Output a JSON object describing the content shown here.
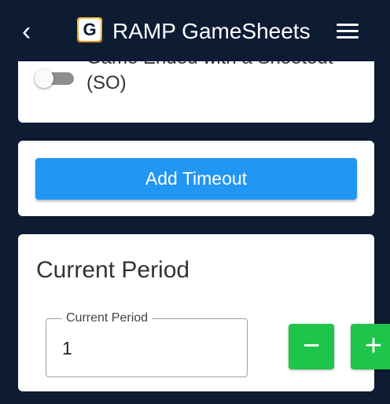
{
  "header": {
    "back_icon": "chevron-left-icon",
    "logo_letter": "G",
    "title": "RAMP GameSheets",
    "menu_icon": "hamburger-menu-icon"
  },
  "shootout": {
    "label": "Game Ended with a Shootout (SO)",
    "toggle_on": false
  },
  "timeout": {
    "button_label": "Add Timeout"
  },
  "current_period": {
    "section_title": "Current Period",
    "field_label": "Current Period",
    "value": "1",
    "decrement_symbol": "−",
    "increment_symbol": "+"
  },
  "colors": {
    "header_bg": "#0d1b33",
    "primary": "#2196f3",
    "success": "#1fc44a"
  }
}
